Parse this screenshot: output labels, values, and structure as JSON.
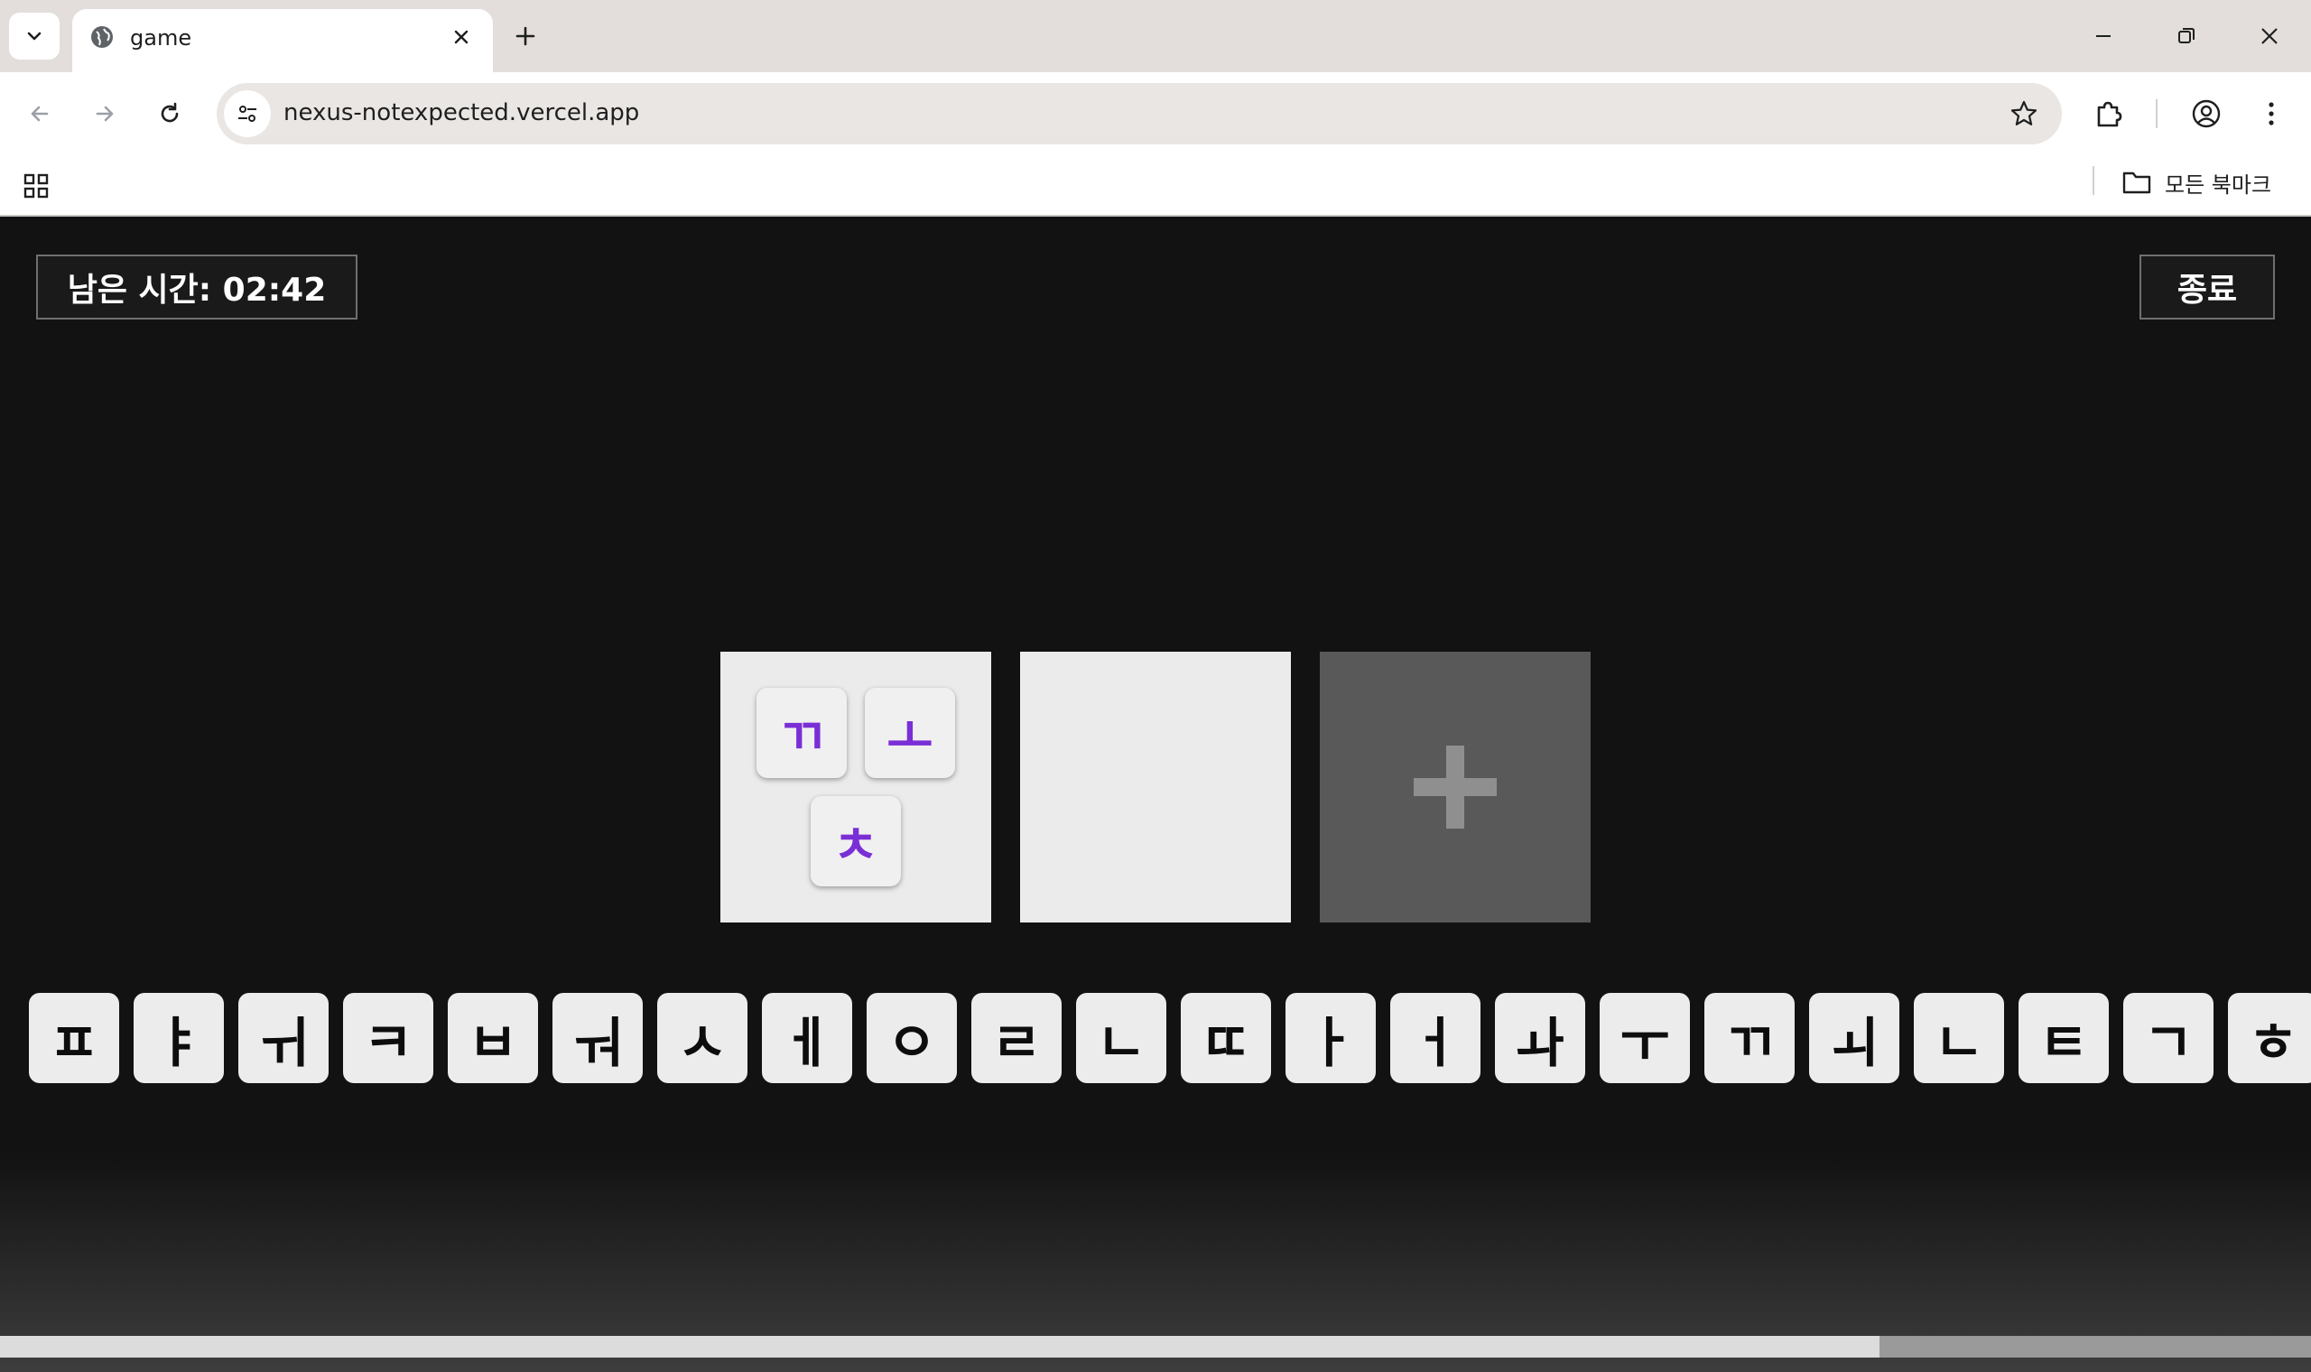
{
  "browser": {
    "tab": {
      "title": "game",
      "favicon": "globe-icon"
    },
    "address": {
      "url": "nexus-notexpected.vercel.app"
    },
    "bookmarks_bar": {
      "all_bookmarks_label": "모든 북마크"
    }
  },
  "game": {
    "timer_label": "남은 시간: 02:42",
    "end_button_label": "종료",
    "slots": [
      {
        "tiles": [
          "ㄲ",
          "ㅗ",
          "ㅊ"
        ]
      },
      {
        "tiles": []
      },
      {
        "type": "add-slot",
        "icon": "plus-icon"
      }
    ],
    "tray_keys": [
      "ㅍ",
      "ㅑ",
      "ㅟ",
      "ㅋ",
      "ㅂ",
      "ㅝ",
      "ㅅ",
      "ㅔ",
      "ㅇ",
      "ㄹ",
      "ㄴ",
      "ㄸ",
      "ㅏ",
      "ㅓ",
      "ㅘ",
      "ㅜ",
      "ㄲ",
      "ㅚ",
      "ㄴ",
      "ㅌ",
      "ㄱ",
      "ㅎ"
    ],
    "colors": {
      "tile_letter": "#7a2fd6",
      "background": "#121212",
      "slot": "#ebebeb",
      "add_slot": "#595959"
    }
  }
}
